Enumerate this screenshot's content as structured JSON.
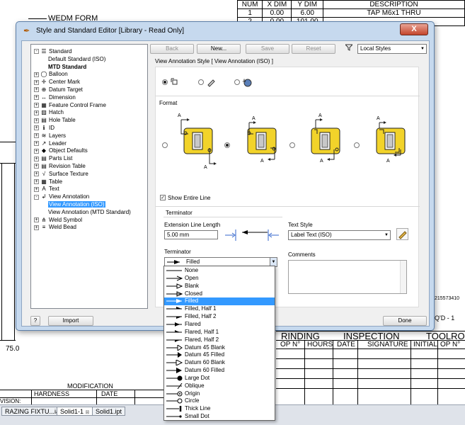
{
  "background": {
    "wedm_label": "WEDM FORM",
    "table_headers": [
      "NUM",
      "X DIM",
      "Y DIM",
      "DESCRIPTION"
    ],
    "table_rows": [
      [
        "1",
        "0.00",
        "6.00",
        "TAP M6x1 THRU"
      ],
      [
        "2",
        "0.00",
        "101.00",
        ""
      ]
    ],
    "dim_75": "75.0",
    "modification": "MODIFICATION",
    "hardness": "HARDNESS",
    "date": "DATE",
    "grinding": "RINDING",
    "inspection": "INSPECTION",
    "toolro": "TOOLRO",
    "op_no": "OP N°",
    "hours": "HOURS",
    "date2": "DATE",
    "signature": "SIGNATURE",
    "initial": "INITIAL",
    "op_no2": "OP N°",
    "part_no": "215573410",
    "qty": "Q'D - 1",
    "razing": "RAZING FIXTU...iam",
    "vision": "VISION:"
  },
  "taskbar": {
    "tabs": [
      "RAZING FIXTU...iam",
      "Solid1-1",
      "Solid1.ipt"
    ]
  },
  "dialog": {
    "title": "Style and Standard Editor [Library - Read Only]",
    "close": "X",
    "tree": [
      {
        "label": "Standard",
        "level": 0,
        "exp": "-",
        "icon": "standard-icon"
      },
      {
        "label": "Default Standard (ISO)",
        "level": 1
      },
      {
        "label": "MTD Standard",
        "level": 1,
        "bold": true
      },
      {
        "label": "Balloon",
        "level": 0,
        "exp": "+",
        "icon": "balloon-icon"
      },
      {
        "label": "Center Mark",
        "level": 0,
        "exp": "+",
        "icon": "center-mark-icon"
      },
      {
        "label": "Datum Target",
        "level": 0,
        "exp": "+",
        "icon": "datum-target-icon"
      },
      {
        "label": "Dimension",
        "level": 0,
        "exp": "+",
        "icon": "dimension-icon"
      },
      {
        "label": "Feature Control Frame",
        "level": 0,
        "exp": "+",
        "icon": "fcf-icon"
      },
      {
        "label": "Hatch",
        "level": 0,
        "exp": "+",
        "icon": "hatch-icon"
      },
      {
        "label": "Hole Table",
        "level": 0,
        "exp": "+",
        "icon": "hole-table-icon"
      },
      {
        "label": "ID",
        "level": 0,
        "exp": "+",
        "icon": "id-icon"
      },
      {
        "label": "Layers",
        "level": 0,
        "exp": "+",
        "icon": "layers-icon"
      },
      {
        "label": "Leader",
        "level": 0,
        "exp": "+",
        "icon": "leader-icon"
      },
      {
        "label": "Object Defaults",
        "level": 0,
        "exp": "+",
        "icon": "object-defaults-icon"
      },
      {
        "label": "Parts List",
        "level": 0,
        "exp": "+",
        "icon": "parts-list-icon"
      },
      {
        "label": "Revision Table",
        "level": 0,
        "exp": "+",
        "icon": "revision-table-icon"
      },
      {
        "label": "Surface Texture",
        "level": 0,
        "exp": "+",
        "icon": "surface-texture-icon"
      },
      {
        "label": "Table",
        "level": 0,
        "exp": "+",
        "icon": "table-icon"
      },
      {
        "label": "Text",
        "level": 0,
        "exp": "+",
        "icon": "text-icon"
      },
      {
        "label": "View Annotation",
        "level": 0,
        "exp": "-",
        "icon": "view-annotation-icon"
      },
      {
        "label": "View Annotation (ISO)",
        "level": 1,
        "selected": true
      },
      {
        "label": "View Annotation (MTD Standard)",
        "level": 1
      },
      {
        "label": "Weld Symbol",
        "level": 0,
        "exp": "+",
        "icon": "weld-symbol-icon"
      },
      {
        "label": "Weld Bead",
        "level": 0,
        "exp": "+",
        "icon": "weld-bead-icon"
      }
    ],
    "toolbar": {
      "back": "Back",
      "new": "New...",
      "save": "Save",
      "reset": "Reset",
      "filter": "Local Styles"
    },
    "heading": "View Annotation Style [ View Annotation (ISO) ]",
    "format_label": "Format",
    "show_entire_line": "Show Entire Line",
    "terminator_group": "Terminator",
    "extension_line_length": "Extension Line Length",
    "extension_value": "5.00 mm",
    "terminator_label": "Terminator",
    "terminator_value": "Filled",
    "text_style_label": "Text Style",
    "text_style_value": "Label Text (ISO)",
    "comments_label": "Comments",
    "import": "Import",
    "done": "Done",
    "help": "?"
  },
  "dropdown": {
    "items": [
      "None",
      "Open",
      "Blank",
      "Closed",
      "Filled",
      "Filled, Half 1",
      "Filled, Half 2",
      "Flared",
      "Flared, Half 1",
      "Flared, Half 2",
      "Datum 45 Blank",
      "Datum 45 Filled",
      "Datum 60 Blank",
      "Datum 60 Filled",
      "Large Dot",
      "Oblique",
      "Origin",
      "Circle",
      "Thick Line",
      "Small Dot"
    ],
    "selected": "Filled"
  }
}
